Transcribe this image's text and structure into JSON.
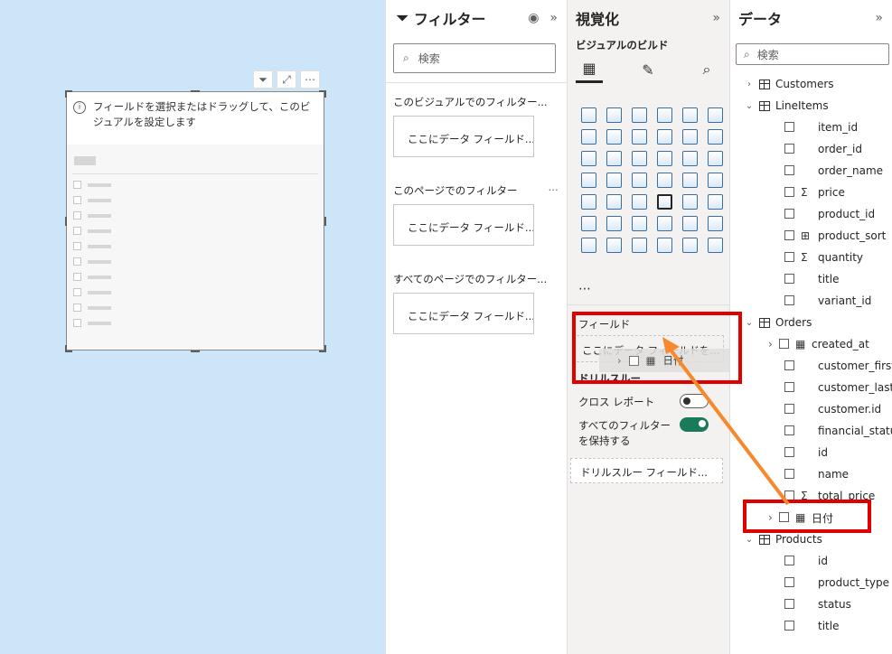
{
  "visual": {
    "message": "フィールドを選択またはドラッグして、このビジュアルを設定します",
    "tools": [
      "filter-icon",
      "focus-mode-icon",
      "more-options-icon"
    ],
    "tool_glyphs": [
      "⏷",
      "⤢",
      "⋯"
    ]
  },
  "filters": {
    "title": "フィルター",
    "search_placeholder": "検索",
    "sections": [
      {
        "label": "このビジュアルでのフィルター...",
        "dots": "",
        "drop": "ここにデータ フィールド..."
      },
      {
        "label": "このページでのフィルター",
        "dots": "⋯",
        "drop": "ここにデータ フィールド..."
      },
      {
        "label": "すべてのページでのフィルター...",
        "dots": "",
        "drop": "ここにデータ フィールド..."
      }
    ]
  },
  "viz": {
    "title": "視覚化",
    "subtitle": "ビジュアルのビルド",
    "more": "⋯",
    "fields_label": "フィールド",
    "fields_drop": "ここにデータ フィールドを...",
    "ghost_label": "日付",
    "drill_label": "ドリルスルー",
    "cross_report": "クロス レポート",
    "keep_filters": "すべてのフィルターを保持する",
    "drill_drop": "ドリルスルー フィールド...",
    "cross_report_on": false,
    "keep_filters_on": true
  },
  "data": {
    "title": "データ",
    "search_placeholder": "検索",
    "tree": [
      {
        "kind": "table",
        "label": "Customers",
        "expanded": false
      },
      {
        "kind": "table",
        "label": "LineItems",
        "expanded": true
      },
      {
        "kind": "field",
        "label": "item_id",
        "icon": ""
      },
      {
        "kind": "field",
        "label": "order_id",
        "icon": ""
      },
      {
        "kind": "field",
        "label": "order_name",
        "icon": ""
      },
      {
        "kind": "field",
        "label": "price",
        "icon": "Σ"
      },
      {
        "kind": "field",
        "label": "product_id",
        "icon": ""
      },
      {
        "kind": "field",
        "label": "product_sort",
        "icon": "⊞"
      },
      {
        "kind": "field",
        "label": "quantity",
        "icon": "Σ"
      },
      {
        "kind": "field",
        "label": "title",
        "icon": ""
      },
      {
        "kind": "field",
        "label": "variant_id",
        "icon": ""
      },
      {
        "kind": "table",
        "label": "Orders",
        "expanded": true
      },
      {
        "kind": "datefield",
        "label": "created_at"
      },
      {
        "kind": "field",
        "label": "customer_first_...",
        "icon": ""
      },
      {
        "kind": "field",
        "label": "customer_last_...",
        "icon": ""
      },
      {
        "kind": "field",
        "label": "customer.id",
        "icon": ""
      },
      {
        "kind": "field",
        "label": "financial_status",
        "icon": ""
      },
      {
        "kind": "field",
        "label": "id",
        "icon": ""
      },
      {
        "kind": "field",
        "label": "name",
        "icon": ""
      },
      {
        "kind": "field",
        "label": "total_price",
        "icon": "Σ"
      },
      {
        "kind": "datefield",
        "label": "日付"
      },
      {
        "kind": "table",
        "label": "Products",
        "expanded": true
      },
      {
        "kind": "field",
        "label": "id",
        "icon": ""
      },
      {
        "kind": "field",
        "label": "product_type",
        "icon": ""
      },
      {
        "kind": "field",
        "label": "status",
        "icon": ""
      },
      {
        "kind": "field",
        "label": "title",
        "icon": ""
      }
    ]
  },
  "colors": {
    "canvas": "#cce5f8",
    "highlight": "#e00000",
    "arrow": "#f5892b",
    "toggle_on": "#1b7a5a"
  }
}
